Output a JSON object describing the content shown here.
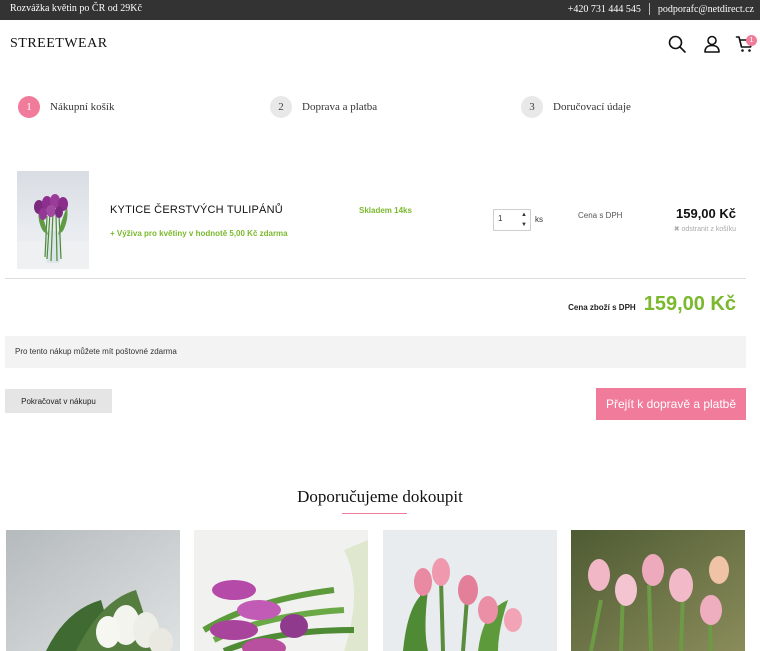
{
  "topbar": {
    "promo": "Rozvážka květin po ČR od 29Kč",
    "phone": "+420 731 444 545",
    "email": "podporafc@netdirect.cz"
  },
  "header": {
    "logo": "STREETWEAR",
    "icons": [
      "search-icon",
      "user-icon",
      "cart-icon"
    ],
    "cart_count": "1"
  },
  "steps": [
    {
      "number": "1",
      "label": "Nákupní košík",
      "active": true
    },
    {
      "number": "2",
      "label": "Doprava a platba",
      "active": false
    },
    {
      "number": "3",
      "label": "Doručovací údaje",
      "active": false
    }
  ],
  "cart": {
    "items": [
      {
        "name": "KYTICE ČERSTVÝCH TULIPÁNŮ",
        "gift": "+ Výživa pro květiny v hodnotě 5,00 Kč zdarma",
        "stock": "Skladem 14ks",
        "quantity": "1",
        "unit": "ks",
        "price_label": "Cena s DPH",
        "price": "159,00 Kč",
        "remove_label": "odstranit z košíku"
      }
    ],
    "total_label": "Cena zboží s DPH",
    "total_value": "159,00 Kč",
    "shipping_note": "Pro tento nákup můžete mít poštovné zdarma",
    "continue_label": "Pokračovat v nákupu",
    "next_label": "Přejít k dopravě a platbě"
  },
  "recommend": {
    "title": "Doporučujeme dokoupit"
  },
  "colors": {
    "accent": "#f07b9a",
    "green": "#7ab92e",
    "topbar": "#333333"
  }
}
